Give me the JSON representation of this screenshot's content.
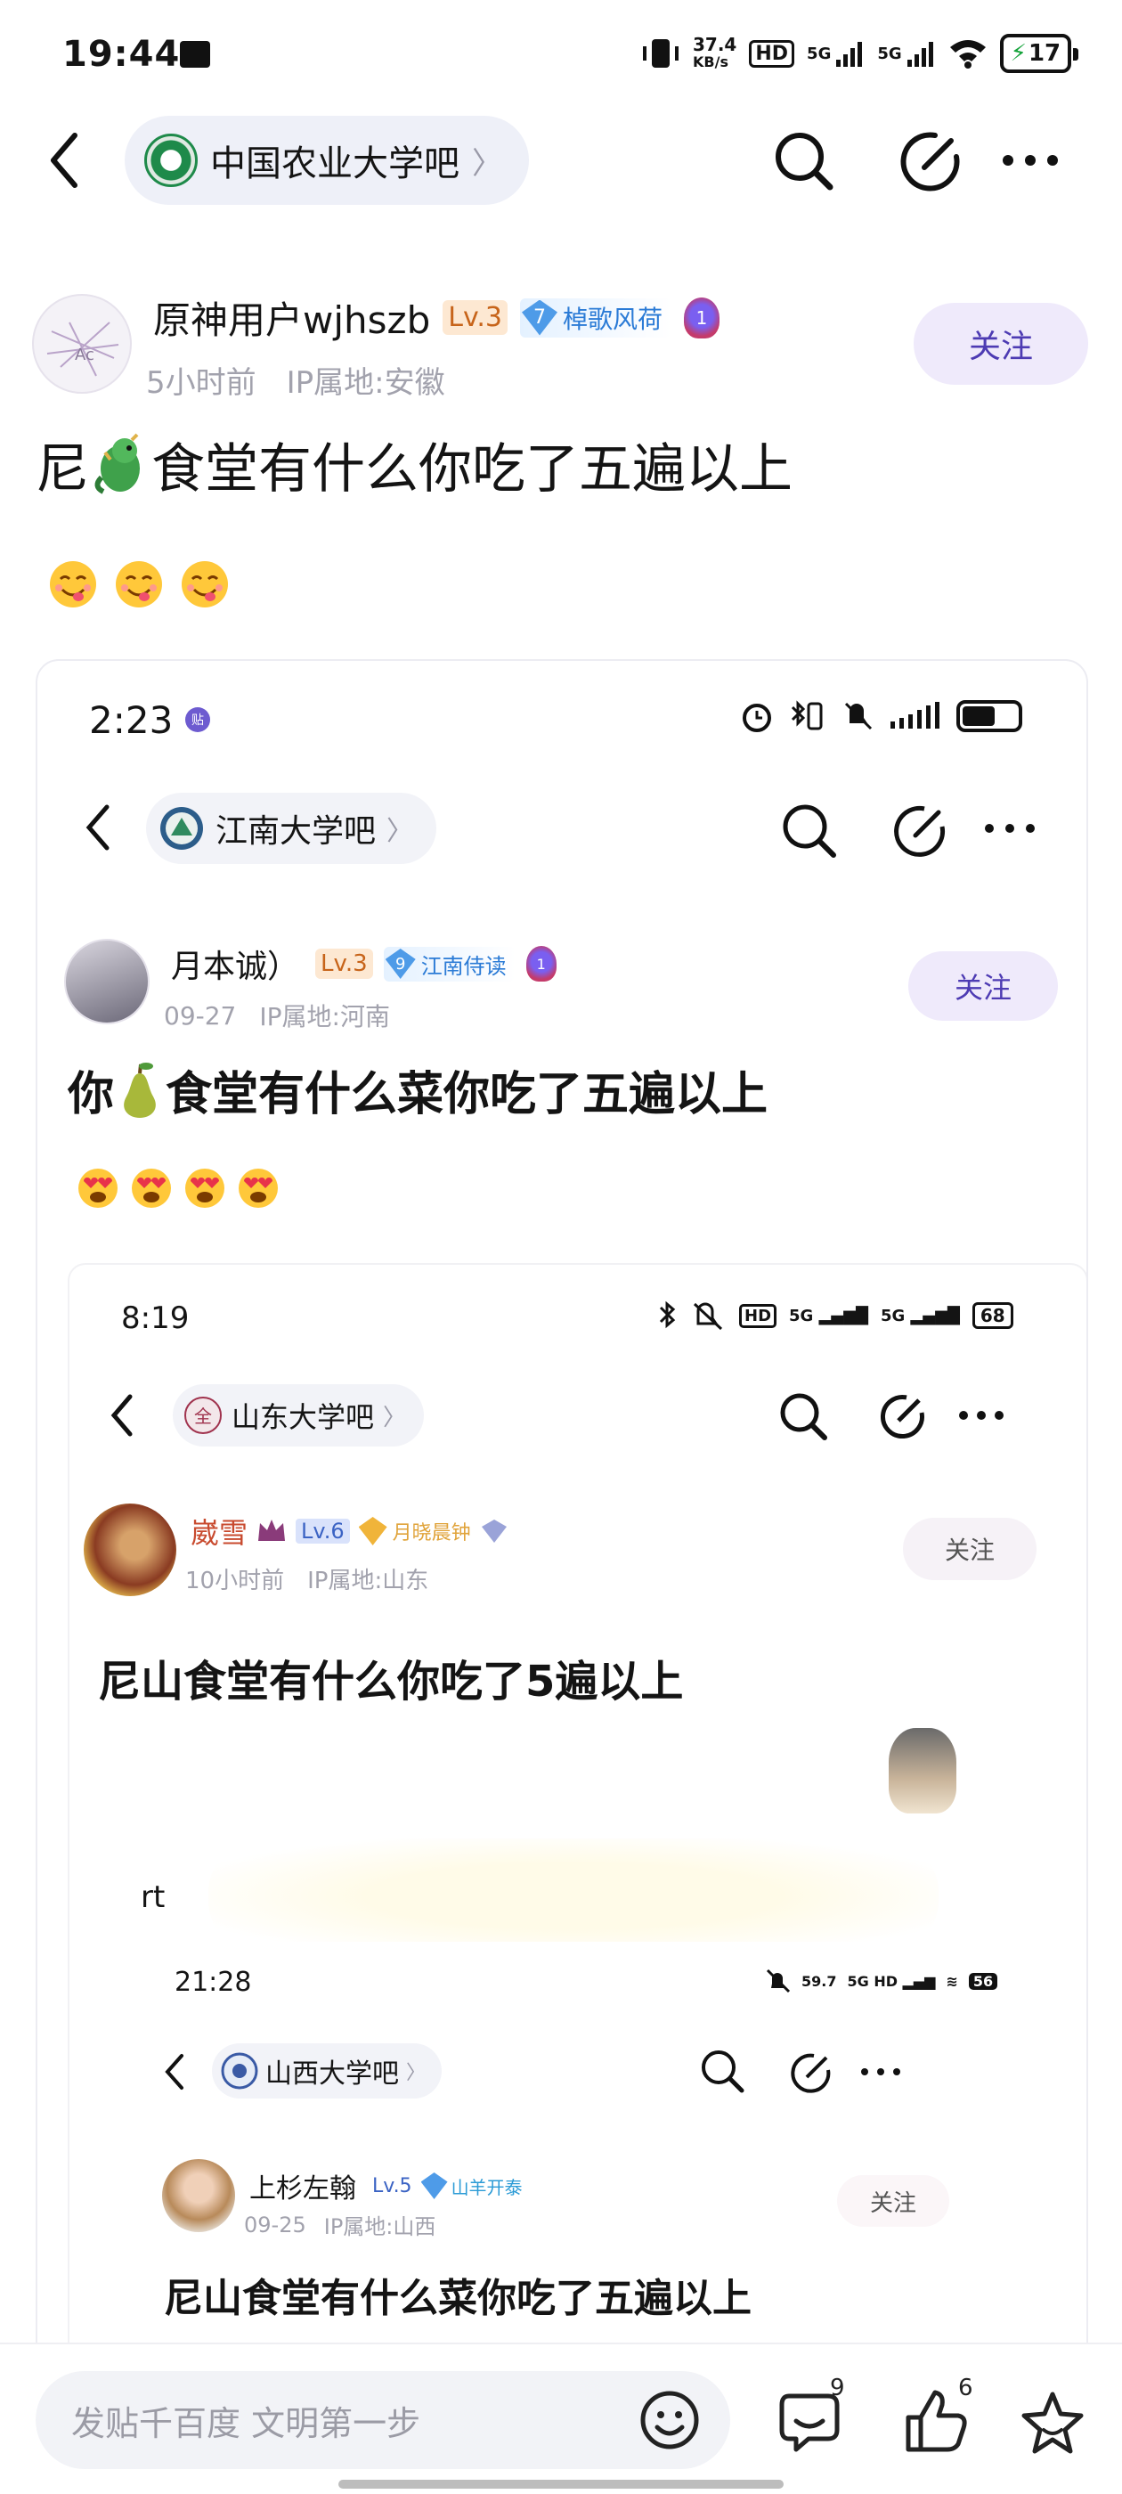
{
  "status_bar": {
    "time": "19:44",
    "net_speed_top": "37.4",
    "net_speed_unit": "KB/s",
    "hd_label": "HD",
    "sig1": "5G",
    "sig2": "5G",
    "battery": "17"
  },
  "nav": {
    "forum_name": "中国农业大学吧"
  },
  "post": {
    "author": "原神用户wjhszb",
    "level": "Lv.3",
    "honor_num": "7",
    "honor": "棹歌风荷",
    "medal_num": "1",
    "time": "5小时前",
    "ip": "IP属地:安徽",
    "follow": "关注",
    "title_before": "尼",
    "title_after": "食堂有什么你吃了五遍以上"
  },
  "shot1": {
    "time": "2:23",
    "forum_name": "江南大学吧",
    "author": "月本诚）",
    "level": "Lv.3",
    "honor_num": "9",
    "honor": "江南侍读",
    "medal_num": "1",
    "date": "09-27",
    "ip": "IP属地:河南",
    "follow": "关注",
    "title_before": "你",
    "title_after": "食堂有什么菜你吃了五遍以上"
  },
  "shot2": {
    "time": "8:19",
    "forum_name": "山东大学吧",
    "author": "崴雪",
    "level": "Lv.6",
    "honor": "月晓晨钟",
    "time_ago": "10小时前",
    "ip": "IP属地:山东",
    "follow": "关注",
    "battery": "68",
    "title": "尼山食堂有什么你吃了5遍以上",
    "rt": "rt"
  },
  "shot3": {
    "time": "21:28",
    "net_speed": "59.7",
    "battery": "56",
    "forum_name": "山西大学吧",
    "author": "上杉左翰",
    "level": "Lv.5",
    "honor": "山羊开泰",
    "date": "09-25",
    "ip": "IP属地:山西",
    "follow": "关注",
    "title": "尼山食堂有什么菜你吃了五遍以上"
  },
  "bottom": {
    "placeholder": "发贴千百度 文明第一步",
    "comment_count": "9",
    "like_count": "6"
  }
}
